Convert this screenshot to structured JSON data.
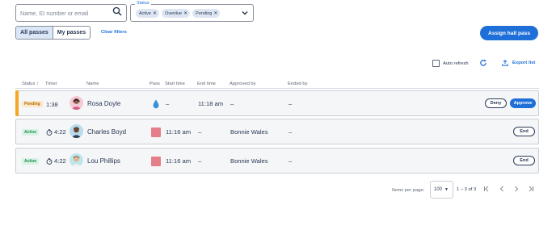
{
  "search": {
    "placeholder": "Name, ID number or email"
  },
  "status_filter": {
    "legend": "Status",
    "chips": [
      "Active",
      "Overdue",
      "Pending"
    ]
  },
  "view_toggle": {
    "all": "All passes",
    "mine": "My passes"
  },
  "clear_filters": "Clear filters",
  "assign_button": "Assign hall pass",
  "toolbar": {
    "auto_refresh": "Auto refresh",
    "export": "Export list"
  },
  "columns": {
    "status": "Status",
    "timer": "Timer",
    "name": "Name",
    "pass": "Pass",
    "start": "Start time",
    "end": "End time",
    "approved_by": "Approved by",
    "ended_by": "Ended by"
  },
  "rows": [
    {
      "status": "Pending",
      "timer": "1:38",
      "name": "Rosa Doyle",
      "pass_icon": "water-drop-icon",
      "start": "–",
      "end": "11:18 am",
      "approved_by": "–",
      "ended_by": "–",
      "actions": [
        "Deny",
        "Approve"
      ]
    },
    {
      "status": "Active",
      "timer": "4:22",
      "name": "Charles Boyd",
      "pass_icon": "restroom-flag-icon",
      "start": "11:16 am",
      "end": "–",
      "approved_by": "Bonnie Wales",
      "ended_by": "–",
      "actions": [
        "End"
      ]
    },
    {
      "status": "Active",
      "timer": "4:22",
      "name": "Lou Phillips",
      "pass_icon": "restroom-flag-icon",
      "start": "11:16 am",
      "end": "–",
      "approved_by": "Bonnie Wales",
      "ended_by": "–",
      "actions": [
        "End"
      ]
    }
  ],
  "pagination": {
    "label": "Items per page:",
    "per_page": "100",
    "range": "1 – 3 of 3"
  },
  "colors": {
    "accent": "#1f6fd8",
    "pending_bar": "#f5a623",
    "pass_flag": "#e37e8a"
  }
}
